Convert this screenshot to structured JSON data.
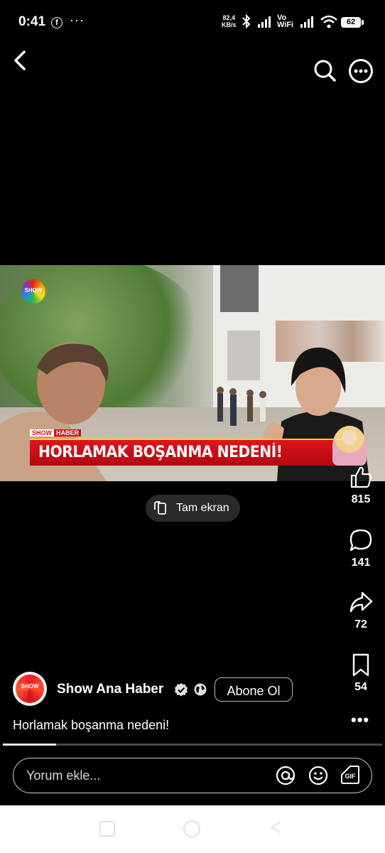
{
  "status_bar": {
    "time": "0:41",
    "facebook_icon": "facebook-icon",
    "more": "···",
    "speed_value": "82,4",
    "speed_unit": "KB/s",
    "vo": "Vo",
    "wifi_label": "WiFi",
    "battery": "62"
  },
  "video": {
    "channel_logo": "SHOW",
    "banner_tag_left": "SHOW",
    "banner_tag_right": "HABER",
    "headline": "HORLAMAK BOŞANMA NEDENİ!"
  },
  "fullscreen_button": {
    "label": "Tam ekran"
  },
  "actions": {
    "likes": "815",
    "comments": "141",
    "shares": "72",
    "saves": "54"
  },
  "channel": {
    "avatar_text": "SHOW",
    "name": "Show Ana Haber",
    "subscribe_label": "Abone Ol"
  },
  "caption": "Horlamak boşanma nedeni!",
  "progress": {
    "fraction": 0.14
  },
  "comment_bar": {
    "placeholder": "Yorum ekle..."
  },
  "colors": {
    "banner_red": "#d01018",
    "banner_border": "#ffd600"
  }
}
